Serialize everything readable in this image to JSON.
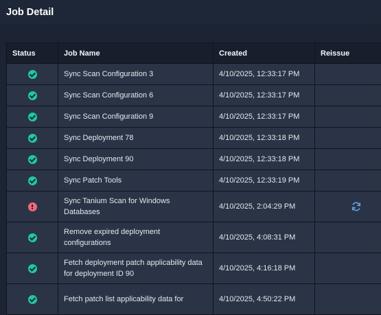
{
  "header": {
    "title": "Job Detail"
  },
  "table": {
    "columns": {
      "status": "Status",
      "job_name": "Job Name",
      "created": "Created",
      "reissue": "Reissue"
    },
    "rows": [
      {
        "status": "success",
        "job_name": "Sync Scan Configuration 3",
        "created": "4/10/2025, 12:33:17 PM",
        "reissue": false
      },
      {
        "status": "success",
        "job_name": "Sync Scan Configuration 6",
        "created": "4/10/2025, 12:33:17 PM",
        "reissue": false
      },
      {
        "status": "success",
        "job_name": "Sync Scan Configuration 9",
        "created": "4/10/2025, 12:33:17 PM",
        "reissue": false
      },
      {
        "status": "success",
        "job_name": "Sync Deployment 78",
        "created": "4/10/2025, 12:33:18 PM",
        "reissue": false
      },
      {
        "status": "success",
        "job_name": "Sync Deployment 90",
        "created": "4/10/2025, 12:33:18 PM",
        "reissue": false
      },
      {
        "status": "success",
        "job_name": "Sync Patch Tools",
        "created": "4/10/2025, 12:33:19 PM",
        "reissue": false
      },
      {
        "status": "error",
        "job_name": "Sync Tanium Scan for Windows Databases",
        "created": "4/10/2025, 2:04:29 PM",
        "reissue": true
      },
      {
        "status": "success",
        "job_name": "Remove expired deployment configurations",
        "created": "4/10/2025, 4:08:31 PM",
        "reissue": false
      },
      {
        "status": "success",
        "job_name": "Fetch deployment patch applicability data for deployment ID 90",
        "created": "4/10/2025, 4:16:18 PM",
        "reissue": false
      },
      {
        "status": "success",
        "job_name": "Fetch patch list applicability data for",
        "created": "4/10/2025, 4:50:22 PM",
        "reissue": false
      }
    ]
  },
  "colors": {
    "success": "#1ec9a0",
    "error": "#ef6b79",
    "reissue_icon": "#5fa3e6"
  },
  "icons": {
    "success": "check-circle-icon",
    "error": "exclamation-circle-icon",
    "reissue": "refresh-icon"
  }
}
